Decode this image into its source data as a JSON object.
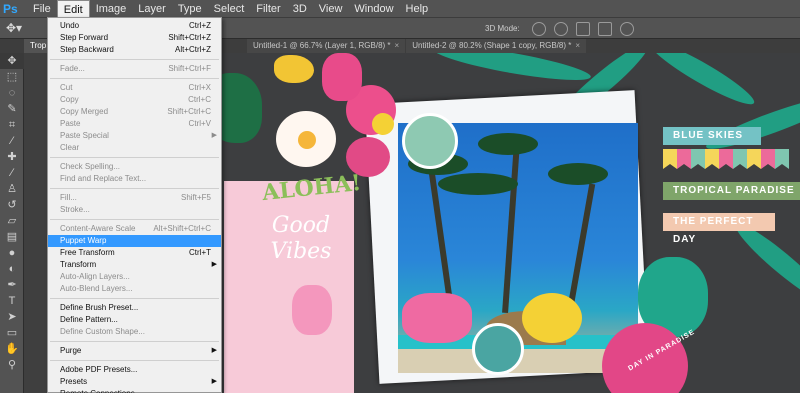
{
  "app": {
    "logo": "Ps"
  },
  "menubar": {
    "items": [
      "File",
      "Edit",
      "Image",
      "Layer",
      "Type",
      "Select",
      "Filter",
      "3D",
      "View",
      "Window",
      "Help"
    ],
    "active_index": 1
  },
  "options": {
    "mode_label": "3D Mode:"
  },
  "tabs": [
    {
      "label": "Untitled-1 @ 66.7% (Layer 1, RGB/8) *",
      "active": false
    },
    {
      "label": "Untitled-2 @ 80.2% (Shape 1 copy, RGB/8) *",
      "active": false
    }
  ],
  "partial_tab": "Trop",
  "edit_menu": [
    {
      "label": "Undo",
      "shortcut": "Ctrl+Z",
      "disabled": false
    },
    {
      "label": "Step Forward",
      "shortcut": "Shift+Ctrl+Z",
      "disabled": false
    },
    {
      "label": "Step Backward",
      "shortcut": "Alt+Ctrl+Z",
      "disabled": false
    },
    {
      "sep": true
    },
    {
      "label": "Fade...",
      "shortcut": "Shift+Ctrl+F",
      "disabled": true
    },
    {
      "sep": true
    },
    {
      "label": "Cut",
      "shortcut": "Ctrl+X",
      "disabled": true
    },
    {
      "label": "Copy",
      "shortcut": "Ctrl+C",
      "disabled": true
    },
    {
      "label": "Copy Merged",
      "shortcut": "Shift+Ctrl+C",
      "disabled": true
    },
    {
      "label": "Paste",
      "shortcut": "Ctrl+V",
      "disabled": true
    },
    {
      "label": "Paste Special",
      "shortcut": "",
      "submenu": true,
      "disabled": true
    },
    {
      "label": "Clear",
      "shortcut": "",
      "disabled": true
    },
    {
      "sep": true
    },
    {
      "label": "Check Spelling...",
      "shortcut": "",
      "disabled": true
    },
    {
      "label": "Find and Replace Text...",
      "shortcut": "",
      "disabled": true
    },
    {
      "sep": true
    },
    {
      "label": "Fill...",
      "shortcut": "Shift+F5",
      "disabled": true
    },
    {
      "label": "Stroke...",
      "shortcut": "",
      "disabled": true
    },
    {
      "sep": true
    },
    {
      "label": "Content-Aware Scale",
      "shortcut": "Alt+Shift+Ctrl+C",
      "disabled": true
    },
    {
      "label": "Puppet Warp",
      "shortcut": "",
      "disabled": false,
      "highlighted": true
    },
    {
      "label": "Free Transform",
      "shortcut": "Ctrl+T",
      "disabled": false
    },
    {
      "label": "Transform",
      "shortcut": "",
      "submenu": true,
      "disabled": false
    },
    {
      "label": "Auto-Align Layers...",
      "shortcut": "",
      "disabled": true
    },
    {
      "label": "Auto-Blend Layers...",
      "shortcut": "",
      "disabled": true
    },
    {
      "sep": true
    },
    {
      "label": "Define Brush Preset...",
      "shortcut": "",
      "disabled": false
    },
    {
      "label": "Define Pattern...",
      "shortcut": "",
      "disabled": false
    },
    {
      "label": "Define Custom Shape...",
      "shortcut": "",
      "disabled": true
    },
    {
      "sep": true
    },
    {
      "label": "Purge",
      "shortcut": "",
      "submenu": true,
      "disabled": false
    },
    {
      "sep": true
    },
    {
      "label": "Adobe PDF Presets...",
      "shortcut": "",
      "disabled": false
    },
    {
      "label": "Presets",
      "shortcut": "",
      "submenu": true,
      "disabled": false
    },
    {
      "label": "Remote Connections...",
      "shortcut": "",
      "disabled": false
    }
  ],
  "canvas": {
    "aloha": "ALOHA!",
    "good_vibes": "Good Vibes",
    "banner_1": "BLUE SKIES",
    "banner_2": "TROPICAL PARADISE",
    "banner_3": "THE PERFECT DAY",
    "badge_text": "DAY IN PARADISE"
  },
  "colors": {
    "pennants": [
      "#f5d65a",
      "#ec6a9a",
      "#7fc6b0",
      "#f5d65a",
      "#ec6a9a",
      "#7fc6b0",
      "#f5d65a",
      "#ec6a9a",
      "#7fc6b0"
    ]
  }
}
